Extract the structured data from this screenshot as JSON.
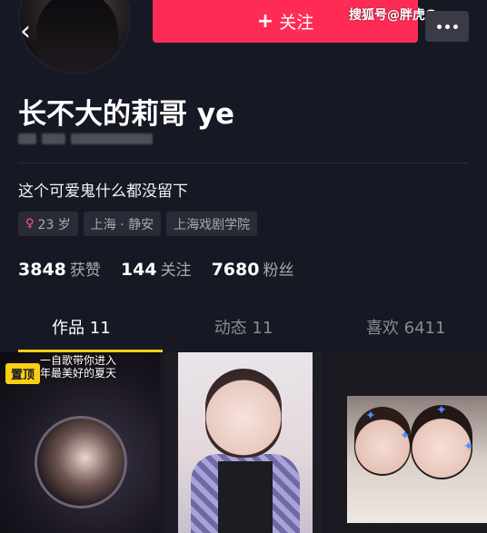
{
  "header": {
    "back_icon": "chevron-left-icon",
    "follow_plus": "+",
    "follow_label": "关注",
    "more_icon": "more-dots-icon",
    "watermark": "搜狐号@胖虎Game"
  },
  "profile": {
    "nickname": "长不大的莉哥 ye",
    "signature": "这个可爱鬼什么都没留下",
    "tags": {
      "gender_icon": "female-icon",
      "gender_symbol": "♀",
      "age": "23 岁",
      "location": "上海 · 静安",
      "school": "上海戏剧学院"
    },
    "stats": [
      {
        "num": "3848",
        "label": "获赞"
      },
      {
        "num": "144",
        "label": "关注"
      },
      {
        "num": "7680",
        "label": "粉丝"
      }
    ]
  },
  "tabs": [
    {
      "label": "作品 11",
      "active": true
    },
    {
      "label": "动态 11",
      "active": false
    },
    {
      "label": "喜欢 6411",
      "active": false
    }
  ],
  "grid": {
    "cell1": {
      "pin_label": "置顶",
      "line1": "一自歌带你进入",
      "line2": "年最美好的夏天"
    }
  },
  "colors": {
    "background": "#161823",
    "accent": "#fe2c55",
    "tab_indicator": "#face15"
  }
}
